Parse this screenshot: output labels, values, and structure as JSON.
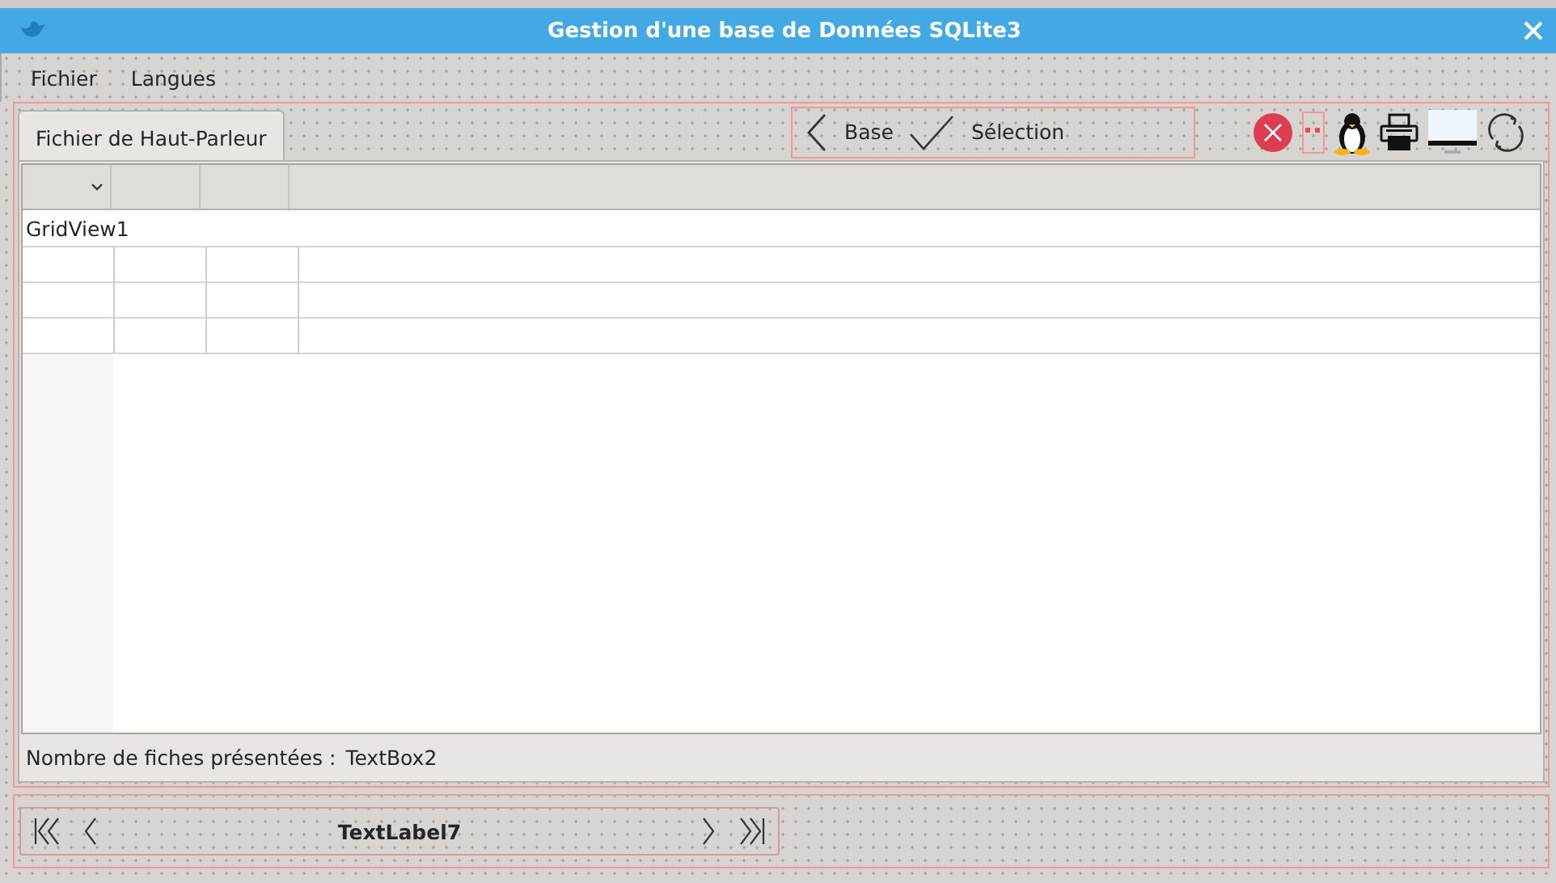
{
  "window": {
    "title": "Gestion d'une base de Données SQLite3"
  },
  "menu": [
    {
      "label": "Fichier"
    },
    {
      "label": "Langues"
    }
  ],
  "tabs": [
    {
      "label": "Fichier de Haut-Parleur",
      "selected": true
    }
  ],
  "toolbar": [
    {
      "label": "Base",
      "kind": "back"
    },
    {
      "label": "Sélection",
      "kind": "check"
    }
  ],
  "grid": {
    "caption": "GridView1"
  },
  "footer": {
    "label": "Nombre de fiches présentées :",
    "value": "TextBox2"
  },
  "navigator": {
    "label": "TextLabel7"
  }
}
